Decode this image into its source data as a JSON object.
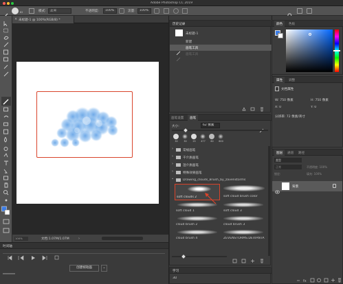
{
  "app": {
    "title": "Adobe Photoshop CC 2019"
  },
  "options": {
    "mode_label": "模式:",
    "mode_value": "正常",
    "opacity_label": "不透明度:",
    "opacity_value": "100%",
    "flow_label": "流量:",
    "flow_value": "100%",
    "brush_size": "62"
  },
  "document": {
    "tab": "未标题-1 @ 100%(RGB/8) *",
    "zoom": "100%",
    "doc_info": "文档:1.07M/1.07M"
  },
  "history": {
    "title": "历史记录",
    "snapshot": "未标题-1",
    "items": [
      {
        "label": "新建"
      },
      {
        "label": "画笔工具"
      },
      {
        "label": "画笔工具"
      }
    ]
  },
  "color_panel": {
    "tabs": [
      "颜色",
      "色板"
    ],
    "accent": "#3b7de8"
  },
  "properties": {
    "tabs": [
      "属性",
      "调整"
    ],
    "section": "文档属性",
    "w_label": "W: 750 像素",
    "h_label": "H: 750 像素",
    "x_label": "X: 0",
    "y_label": "Y: 0",
    "resolution": "分辨率: 72 像素/英寸"
  },
  "brush_panel": {
    "tabs": [
      "画笔设置",
      "画笔"
    ],
    "size_label": "大小:",
    "size_value": "62 像素",
    "preset_sizes": [
      "30",
      "30",
      "25",
      "477",
      "60",
      "600"
    ],
    "groups": [
      "常规画笔",
      "干介质画笔",
      "湿介质画笔",
      "特殊效果画笔",
      "Drawing_clouds_Brush_by_zavenstorms"
    ],
    "brushes": [
      {
        "label": "soft clouds 2"
      },
      {
        "label": "soft cloud brush color"
      },
      {
        "label": "soft cloud 1"
      },
      {
        "label": "soft cloud 3"
      },
      {
        "label": "cloud brush 2"
      },
      {
        "label": "cloud brush 3"
      },
      {
        "label": "cloud brush 4"
      },
      {
        "label": "ZEVENSTORMS.DEVIANTA"
      }
    ]
  },
  "layers": {
    "tabs": [
      "图层",
      "通道",
      "路径"
    ],
    "kind_label": "类型",
    "blend": "正常",
    "opacity": "不透明度: 100%",
    "lock_label": "锁定:",
    "fill": "填充: 100%",
    "layer_name": "背景"
  },
  "learn_panel": {
    "tabs": [
      "学习"
    ],
    "mode": "3D"
  },
  "timeline": {
    "title": "时间轴",
    "create_button": "创建帧动画"
  }
}
